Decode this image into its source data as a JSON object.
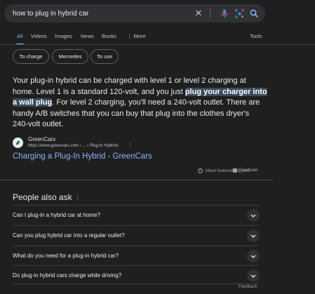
{
  "search": {
    "query": "how to plug in hybrid car",
    "clear_icon": "close-icon",
    "mic_icon": "mic-icon",
    "lens_icon": "lens-icon",
    "search_icon": "search-icon"
  },
  "tabs": [
    {
      "label": "All",
      "active": true
    },
    {
      "label": "Videos"
    },
    {
      "label": "Images"
    },
    {
      "label": "News"
    },
    {
      "label": "Books"
    },
    {
      "label": "⋮ More"
    }
  ],
  "tools_label": "Tools",
  "chips": [
    "To charge",
    "Mercedes",
    "To use"
  ],
  "snippet": {
    "line1": "Your plug-in hybrid can be charged with level 1 or level 2 charging at",
    "line2_pre": "home. Level 1 is a standard 120-volt, and you just ",
    "line2_hl": "plug your charger into",
    "line3_hl": "a wall plug",
    "line3_post": ". For level 2 charging, you'll need a 240-volt outlet. There are",
    "line4": "handy A/B switches that you can buy that plug into the clothes dryer's",
    "line5": "240-volt outlet."
  },
  "source": {
    "site_name": "GreenCars",
    "url": "https://www.greencars.com › ... › Plug-In Hybrids",
    "link_title": "Charging a Plug-In Hybrid - GreenCars"
  },
  "snippet_footer": {
    "about": "About featured snippets",
    "dot": "•",
    "feedback": "Feedback"
  },
  "paa": {
    "title": "People also ask",
    "questions": [
      "Can I plug-in a hybrid car at home?",
      "Can you plug hybrid car into a regular outlet?",
      "What do you need for a plug-in hybrid car?",
      "Do plug-in hybrid cars charge while driving?"
    ],
    "feedback": "Feedback"
  },
  "colors": {
    "background": "#1f1f1f",
    "link": "#8ab4f8",
    "highlight": "#3c4a5c"
  }
}
